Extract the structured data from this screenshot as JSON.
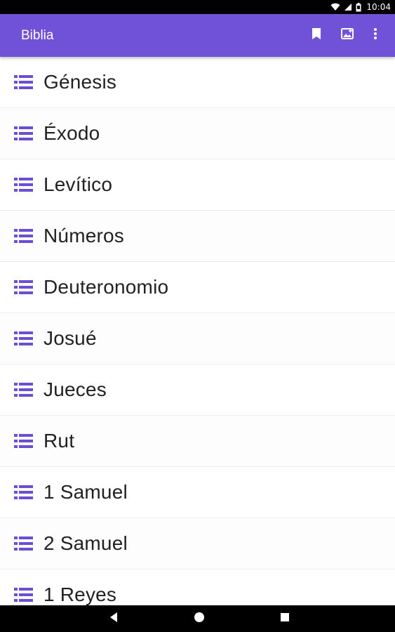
{
  "status_bar": {
    "time": "10:04",
    "icons": [
      "wifi-icon",
      "signal-icon",
      "battery-icon"
    ]
  },
  "app_bar": {
    "title": "Biblia",
    "background_color": "#6f52d8",
    "actions": [
      {
        "icon": "bookmark-icon"
      },
      {
        "icon": "add-to-photos-icon"
      },
      {
        "icon": "more-vert-icon"
      }
    ]
  },
  "book_list": {
    "icon": "list-icon",
    "icon_color": "#6a4fd6",
    "items": [
      {
        "label": "Génesis"
      },
      {
        "label": "Éxodo"
      },
      {
        "label": "Levítico"
      },
      {
        "label": "Números"
      },
      {
        "label": "Deuteronomio"
      },
      {
        "label": "Josué"
      },
      {
        "label": "Jueces"
      },
      {
        "label": "Rut"
      },
      {
        "label": "1 Samuel"
      },
      {
        "label": "2 Samuel"
      },
      {
        "label": "1 Reyes"
      }
    ]
  },
  "nav_bar": {
    "buttons": [
      "back-icon",
      "home-icon",
      "recents-icon"
    ]
  }
}
